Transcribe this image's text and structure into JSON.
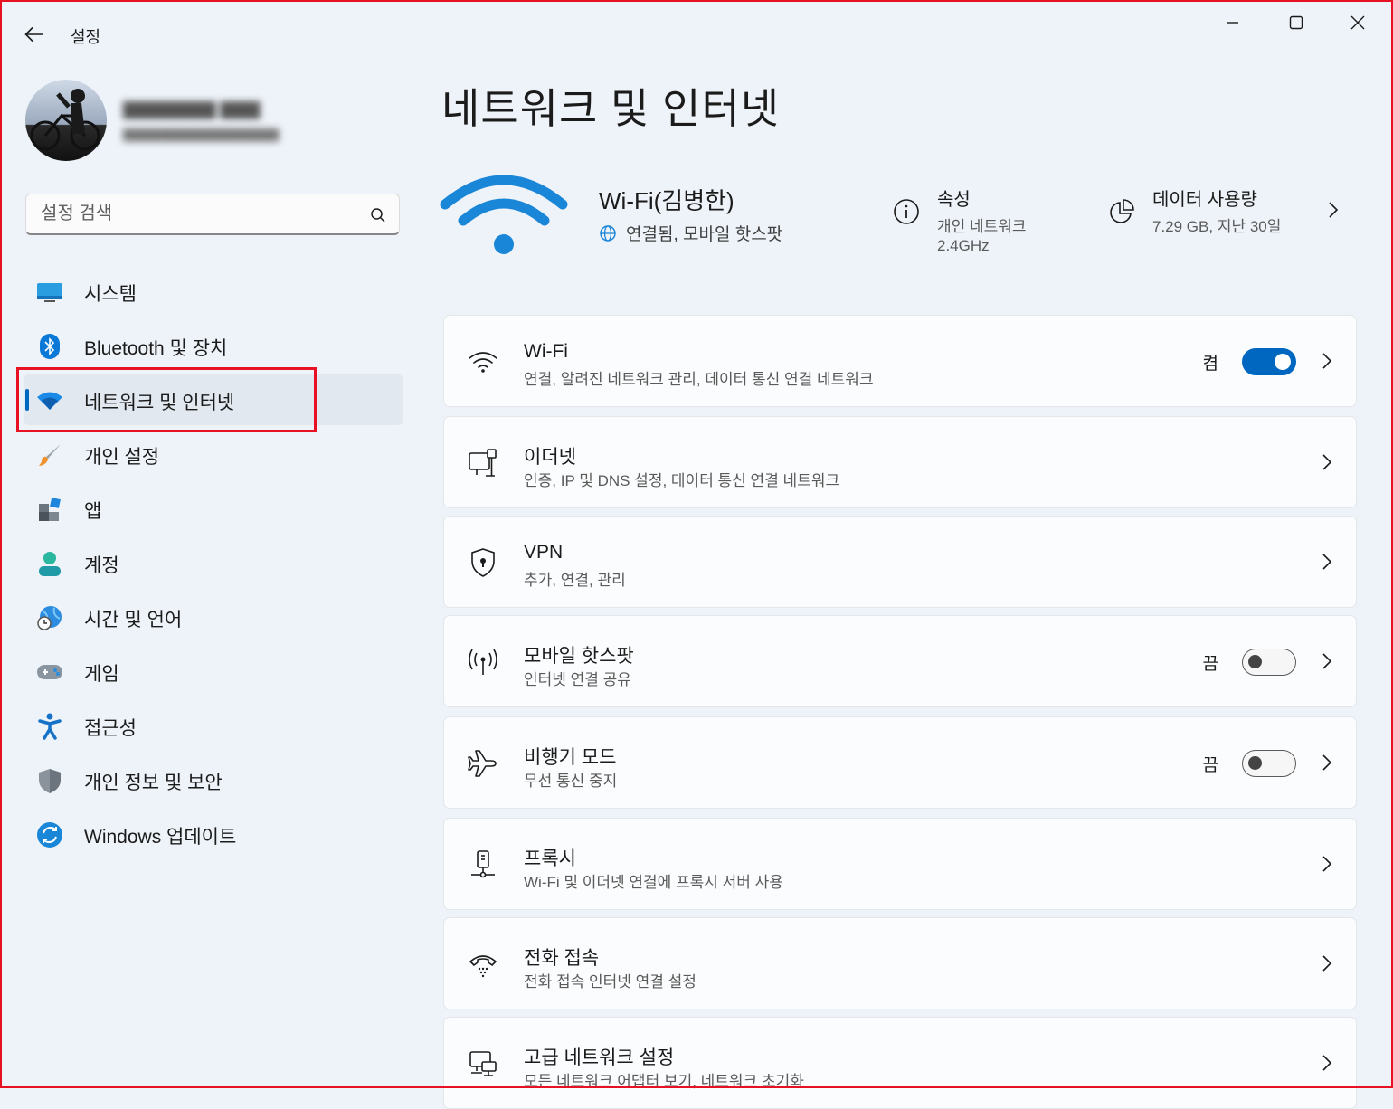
{
  "window": {
    "title": "설정"
  },
  "search": {
    "placeholder": "설정 검색"
  },
  "sidebar": {
    "items": [
      {
        "id": "system",
        "label": "시스템",
        "icon": "monitor-icon"
      },
      {
        "id": "bluetooth",
        "label": "Bluetooth 및 장치",
        "icon": "bluetooth-icon"
      },
      {
        "id": "network",
        "label": "네트워크 및 인터넷",
        "icon": "wifi-icon",
        "active": true
      },
      {
        "id": "personalization",
        "label": "개인 설정",
        "icon": "brush-icon"
      },
      {
        "id": "apps",
        "label": "앱",
        "icon": "apps-icon"
      },
      {
        "id": "accounts",
        "label": "계정",
        "icon": "person-icon"
      },
      {
        "id": "time",
        "label": "시간 및 언어",
        "icon": "globe-clock-icon"
      },
      {
        "id": "gaming",
        "label": "게임",
        "icon": "gamepad-icon"
      },
      {
        "id": "accessibility",
        "label": "접근성",
        "icon": "accessibility-icon"
      },
      {
        "id": "privacy",
        "label": "개인 정보 및 보안",
        "icon": "shield-icon"
      },
      {
        "id": "update",
        "label": "Windows 업데이트",
        "icon": "update-icon"
      }
    ]
  },
  "main": {
    "title": "네트워크 및 인터넷",
    "network": {
      "name": "Wi-Fi(김병한)",
      "status": "연결됨, 모바일 핫스팟"
    },
    "properties": {
      "title": "속성",
      "line1": "개인 네트워크",
      "line2": "2.4GHz"
    },
    "data_usage": {
      "title": "데이터 사용량",
      "value": "7.29 GB, 지난 30일"
    },
    "cards": [
      {
        "id": "wifi",
        "title": "Wi-Fi",
        "sub": "연결, 알려진 네트워크 관리, 데이터 통신 연결 네트워크",
        "toggle": "on",
        "toggle_label": "켬",
        "icon": "wifi-icon"
      },
      {
        "id": "ethernet",
        "title": "이더넷",
        "sub": "인증, IP 및 DNS 설정, 데이터 통신 연결 네트워크",
        "icon": "ethernet-icon"
      },
      {
        "id": "vpn",
        "title": "VPN",
        "sub": "추가, 연결, 관리",
        "icon": "vpn-shield-icon"
      },
      {
        "id": "hotspot",
        "title": "모바일 핫스팟",
        "sub": "인터넷 연결 공유",
        "toggle": "off",
        "toggle_label": "끔",
        "icon": "hotspot-icon"
      },
      {
        "id": "airplane",
        "title": "비행기 모드",
        "sub": "무선 통신 중지",
        "toggle": "off",
        "toggle_label": "끔",
        "icon": "airplane-icon"
      },
      {
        "id": "proxy",
        "title": "프록시",
        "sub": "Wi-Fi 및 이더넷 연결에 프록시 서버 사용",
        "icon": "proxy-icon"
      },
      {
        "id": "dialup",
        "title": "전화 접속",
        "sub": "전화 접속 인터넷 연결 설정",
        "icon": "phone-icon"
      },
      {
        "id": "advanced",
        "title": "고급 네트워크 설정",
        "sub": "모든 네트워크 어댑터 보기, 네트워크 초기화",
        "icon": "network-adapter-icon"
      }
    ]
  },
  "colors": {
    "accent": "#0067c0",
    "highlight": "#e81123"
  }
}
